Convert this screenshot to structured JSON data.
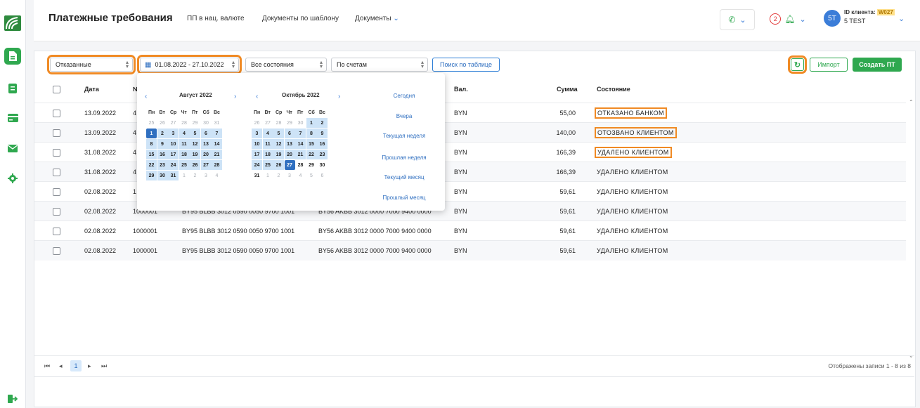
{
  "header": {
    "title": "Платежные требования",
    "nav": [
      "ПП в нац. валюте",
      "Документы по шаблону",
      "Документы"
    ],
    "notifications_count": "2",
    "user_initials": "5T",
    "client_id_label": "ID клиента:",
    "client_id_value": "W027",
    "client_name": "5 TEST"
  },
  "filters": {
    "status_filter": "Отказанные",
    "date_range": "01.08.2022 - 27.10.2022",
    "state_filter": "Все состояния",
    "account_filter": "По счетам",
    "search_button": "Поиск по таблице"
  },
  "actions": {
    "import": "Импорт",
    "create": "Создать ПТ"
  },
  "table": {
    "columns": [
      "Дата",
      "№",
      "Вал.",
      "Сумма",
      "Состояние"
    ],
    "rows": [
      {
        "date": "13.09.2022",
        "number": "4",
        "payer": "",
        "payee": "",
        "currency": "BYN",
        "amount": "55,00",
        "state": "ОТКАЗАНО БАНКОМ"
      },
      {
        "date": "13.09.2022",
        "number": "4",
        "payer": "",
        "payee": "",
        "currency": "BYN",
        "amount": "140,00",
        "state": "ОТОЗВАНО КЛИЕНТОМ"
      },
      {
        "date": "31.08.2022",
        "number": "4",
        "payer": "",
        "payee": "",
        "currency": "BYN",
        "amount": "166,39",
        "state": "УДАЛЕНО КЛИЕНТОМ"
      },
      {
        "date": "31.08.2022",
        "number": "4",
        "payer": "",
        "payee": "",
        "currency": "BYN",
        "amount": "166,39",
        "state": "УДАЛЕНО КЛИЕНТОМ"
      },
      {
        "date": "02.08.2022",
        "number": "1",
        "payer": "",
        "payee": "",
        "currency": "BYN",
        "amount": "59,61",
        "state": "УДАЛЕНО КЛИЕНТОМ"
      },
      {
        "date": "02.08.2022",
        "number": "1000001",
        "payer": "BY95 BLBB 3012 0590 0050 9700 1001",
        "payee": "BY56 AKBB 3012 0000 7000 9400 0000",
        "currency": "BYN",
        "amount": "59,61",
        "state": "УДАЛЕНО КЛИЕНТОМ"
      },
      {
        "date": "02.08.2022",
        "number": "1000001",
        "payer": "BY95 BLBB 3012 0590 0050 9700 1001",
        "payee": "BY56 AKBB 3012 0000 7000 9400 0000",
        "currency": "BYN",
        "amount": "59,61",
        "state": "УДАЛЕНО КЛИЕНТОМ"
      },
      {
        "date": "02.08.2022",
        "number": "1000001",
        "payer": "BY95 BLBB 3012 0590 0050 9700 1001",
        "payee": "BY56 AKBB 3012 0000 7000 9400 0000",
        "currency": "BYN",
        "amount": "59,61",
        "state": "УДАЛЕНО КЛИЕНТОМ"
      }
    ]
  },
  "pagination": {
    "current": "1",
    "summary": "Отображены записи 1 - 8 из 8"
  },
  "datepicker": {
    "left_month": "Август 2022",
    "right_month": "Октябрь 2022",
    "weekdays": [
      "Пн",
      "Вт",
      "Ср",
      "Чт",
      "Пт",
      "Сб",
      "Вс"
    ],
    "left_days": [
      [
        "25",
        "26",
        "27",
        "28",
        "29",
        "30",
        "31"
      ],
      [
        "1",
        "2",
        "3",
        "4",
        "5",
        "6",
        "7"
      ],
      [
        "8",
        "9",
        "10",
        "11",
        "12",
        "13",
        "14"
      ],
      [
        "15",
        "16",
        "17",
        "18",
        "19",
        "20",
        "21"
      ],
      [
        "22",
        "23",
        "24",
        "25",
        "26",
        "27",
        "28"
      ],
      [
        "29",
        "30",
        "31",
        "1",
        "2",
        "3",
        "4"
      ]
    ],
    "right_days": [
      [
        "26",
        "27",
        "28",
        "29",
        "30",
        "1",
        "2"
      ],
      [
        "3",
        "4",
        "5",
        "6",
        "7",
        "8",
        "9"
      ],
      [
        "10",
        "11",
        "12",
        "13",
        "14",
        "15",
        "16"
      ],
      [
        "17",
        "18",
        "19",
        "20",
        "21",
        "22",
        "23"
      ],
      [
        "24",
        "25",
        "26",
        "27",
        "28",
        "29",
        "30"
      ],
      [
        "31",
        "1",
        "2",
        "3",
        "4",
        "5",
        "6"
      ]
    ],
    "quick_ranges": [
      "Сегодня",
      "Вчера",
      "Текущая неделя",
      "Прошлая неделя",
      "Текущий месяц",
      "Прошлый месяц"
    ]
  },
  "colors": {
    "brand_green": "#2fa84f",
    "accent_blue": "#2f6fc0",
    "highlight_orange": "#f08a24"
  }
}
